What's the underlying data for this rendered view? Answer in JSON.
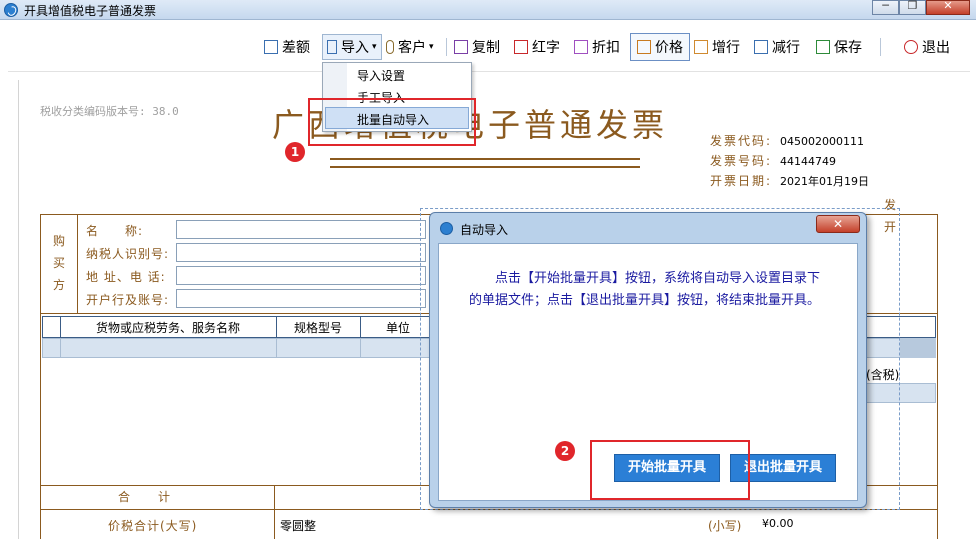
{
  "window": {
    "title": "开具增值税电子普通发票",
    "btn_minimize": "─",
    "btn_restore": "❐",
    "btn_close": "✕"
  },
  "toolbar": {
    "items": [
      {
        "label": "差额",
        "icon": "list-icon"
      },
      {
        "label": "导入",
        "icon": "import-icon",
        "caret": "▾"
      },
      {
        "label": "客户",
        "icon": "user-icon",
        "caret": "▾"
      },
      {
        "label": "复制",
        "icon": "copy-icon"
      },
      {
        "label": "红字",
        "icon": "red-invoice-icon"
      },
      {
        "label": "折扣",
        "icon": "discount-icon"
      },
      {
        "label": "价格",
        "icon": "price-icon"
      },
      {
        "label": "增行",
        "icon": "add-row-icon"
      },
      {
        "label": "减行",
        "icon": "remove-row-icon"
      },
      {
        "label": "保存",
        "icon": "save-icon"
      },
      {
        "label": "退出",
        "icon": "power-icon"
      }
    ]
  },
  "import_menu": {
    "items": [
      "导入设置",
      "手工导入",
      "批量自动导入"
    ],
    "highlighted": "批量自动导入"
  },
  "invoice": {
    "version_label": "税收分类编码版本号: 38.0",
    "title": "广西增值税电子普通发票",
    "meta": [
      {
        "label": "发票代码:",
        "value": "045002000111"
      },
      {
        "label": "发票号码:",
        "value": "44144749"
      },
      {
        "label": "开票日期:",
        "value": "2021年01月19日"
      }
    ],
    "side_fragments": [
      "发",
      "开"
    ],
    "buyer_side": [
      "购",
      "买",
      "方"
    ],
    "buyer_fields": [
      "名　　称:",
      "纳税人识别号:",
      "地 址、电 话:",
      "开户行及账号:"
    ],
    "goods_headers": [
      "货物或应税劳务、服务名称",
      "规格型号",
      "单位"
    ],
    "amount_tax_suffix": "(含税)",
    "total_label": "合计",
    "sum_label": "价税合计(大写)",
    "sum_upper_value": "零圆整",
    "sum_small_label": "(小写)",
    "sum_small_value": "¥0.00"
  },
  "dialog": {
    "title": "自动导入",
    "close_glyph": "✕",
    "message": "点击【开始批量开具】按钮，系统将自动导入设置目录下的单据文件；点击【退出批量开具】按钮，将结束批量开具。",
    "start_button": "开始批量开具",
    "exit_button": "退出批量开具"
  },
  "annotations": {
    "marker_1": "1",
    "marker_2": "2",
    "accent_color": "#e0262b"
  },
  "colors": {
    "invoice_brown": "#8b5a1f",
    "button_blue": "#2b7fd6",
    "dialog_frame": "#b9d1ea"
  }
}
